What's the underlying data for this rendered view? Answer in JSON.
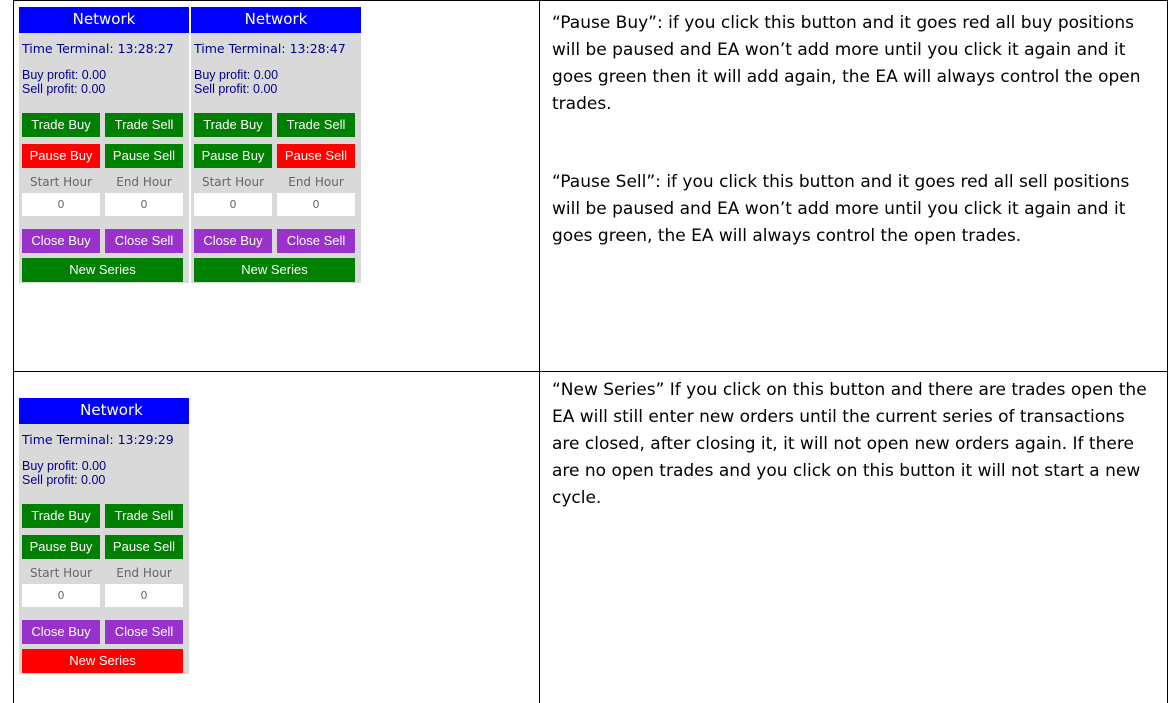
{
  "rows": [
    {
      "panels": [
        {
          "title": "Network",
          "time": "Time Terminal: 13:28:27",
          "buy_profit": "Buy profit: 0.00",
          "sell_profit": "Sell profit: 0.00",
          "buttons": {
            "trade_buy": "Trade Buy",
            "trade_sell": "Trade Sell",
            "pause_buy": "Pause Buy",
            "pause_sell": "Pause Sell",
            "close_buy": "Close Buy",
            "close_sell": "Close Sell",
            "new_series": "New Series"
          },
          "button_colors": {
            "pause_buy": "#ff0000",
            "pause_sell": "#008000",
            "new_series": "#008000"
          },
          "start_hour_label": "Start Hour",
          "end_hour_label": "End Hour",
          "start_hour_value": "0",
          "end_hour_value": "0"
        },
        {
          "title": "Network",
          "time": "Time Terminal: 13:28:47",
          "buy_profit": "Buy profit: 0.00",
          "sell_profit": "Sell profit: 0.00",
          "buttons": {
            "trade_buy": "Trade Buy",
            "trade_sell": "Trade Sell",
            "pause_buy": "Pause Buy",
            "pause_sell": "Pause Sell",
            "close_buy": "Close Buy",
            "close_sell": "Close Sell",
            "new_series": "New Series"
          },
          "button_colors": {
            "pause_buy": "#008000",
            "pause_sell": "#ff0000",
            "new_series": "#008000"
          },
          "start_hour_label": "Start Hour",
          "end_hour_label": "End Hour",
          "start_hour_value": "0",
          "end_hour_value": "0"
        }
      ],
      "description": [
        "“Pause Buy”: if you click this button and it goes red all buy positions will be paused and EA won’t add more until you click it again and it goes green then it will add again, the EA will always control the open trades.",
        "“Pause Sell”: if you click this button and it goes red all sell positions will be paused and EA won’t add more until you click it again and it goes green, the EA will always control the open trades."
      ]
    },
    {
      "panels": [
        {
          "title": "Network",
          "time": "Time Terminal: 13:29:29",
          "buy_profit": "Buy profit: 0.00",
          "sell_profit": "Sell profit: 0.00",
          "buttons": {
            "trade_buy": "Trade Buy",
            "trade_sell": "Trade Sell",
            "pause_buy": "Pause Buy",
            "pause_sell": "Pause Sell",
            "close_buy": "Close Buy",
            "close_sell": "Close Sell",
            "new_series": "New Series"
          },
          "button_colors": {
            "pause_buy": "#008000",
            "pause_sell": "#008000",
            "new_series": "#ff0000"
          },
          "start_hour_label": "Start Hour",
          "end_hour_label": "End Hour",
          "start_hour_value": "0",
          "end_hour_value": "0"
        }
      ],
      "description": [
        "“New Series” If you click on this button and there are trades open the EA will still enter new orders until the current series of transactions are closed, after closing it, it will not open new orders again. If there are no open trades and you click on this button it will not start a new cycle."
      ]
    }
  ]
}
